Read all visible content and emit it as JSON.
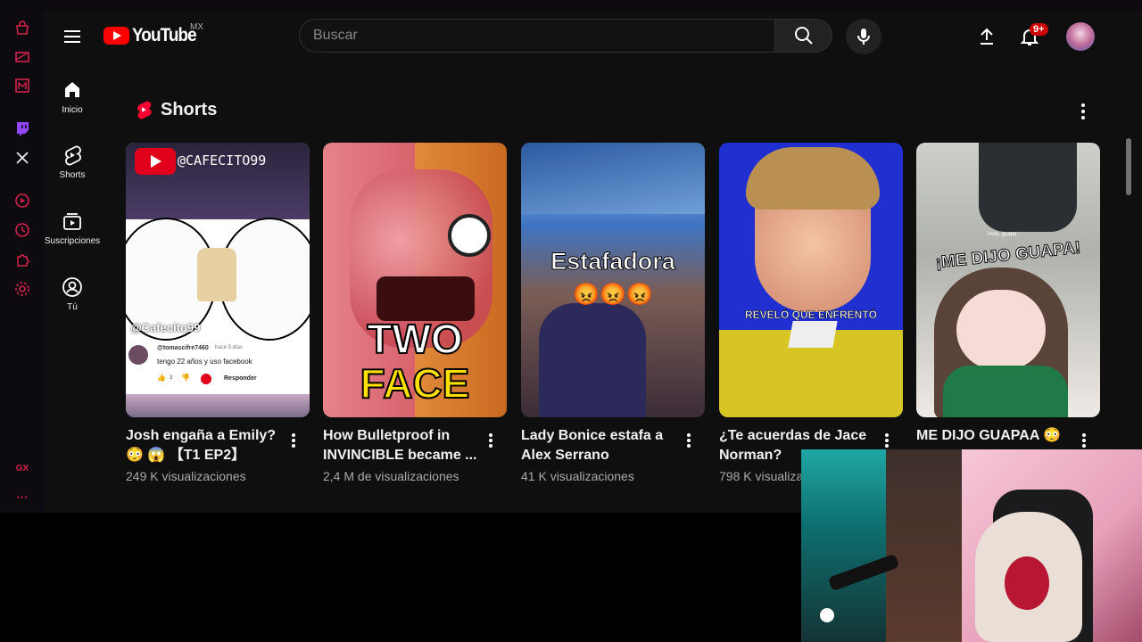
{
  "header": {
    "logo_text": "YouTube",
    "country": "MX",
    "search_placeholder": "Buscar",
    "notifications_badge": "9+"
  },
  "guide": {
    "items": [
      {
        "label": "Inicio",
        "icon": "home-icon"
      },
      {
        "label": "Shorts",
        "icon": "shorts-icon"
      },
      {
        "label": "Suscripciones",
        "icon": "subscriptions-icon"
      },
      {
        "label": "Tú",
        "icon": "you-icon"
      }
    ]
  },
  "opera_sidebar": {
    "icons": [
      "shopping-icon",
      "wallet-icon",
      "music-icon",
      "twitch-icon",
      "x-icon",
      "player-icon",
      "history-icon",
      "extensions-icon",
      "settings-icon",
      "gx-icon",
      "more-icon"
    ],
    "gx_label": "GX",
    "more_label": "···"
  },
  "shorts": {
    "title": "Shorts",
    "items": [
      {
        "title": "Josh engaña a Emily? 😳 😱 【T1 EP2】",
        "views": "249 K visualizaciones",
        "overlay_channel": "@CAFECITO99",
        "overlay_handle": "@Cafecito99",
        "comment_user": "@tomascifre7460",
        "comment_time": "hace 5 días",
        "comment_text": "tengo 22 años y uso facebook",
        "comment_likes": "3",
        "comment_reply": "Responder"
      },
      {
        "title": "How Bulletproof in INVINCIBLE became ...",
        "views": "2,4 M de visualizaciones",
        "overlay_line1": "TWO",
        "overlay_line2": "FACE"
      },
      {
        "title": "Lady Bonice estafa a Alex Serrano",
        "views": "41 K visualizaciones",
        "overlay_text": "Estafadora",
        "overlay_emoji": "😡😡😡"
      },
      {
        "title": "¿Te acuerdas de Jace Norman?",
        "views": "798 K visualizaciones",
        "overlay_text": "REVELÓ QUE ENFRENTÓ"
      },
      {
        "title": "ME DIJO GUAPAA 😳",
        "views": "",
        "overlay_text": "¡ME DIJO GUAPA!",
        "overlay_small": "Hola, guapa"
      }
    ]
  },
  "colors": {
    "accent": "#ff0000",
    "gx_red": "#d3224b",
    "bg": "#0f0f0f"
  }
}
